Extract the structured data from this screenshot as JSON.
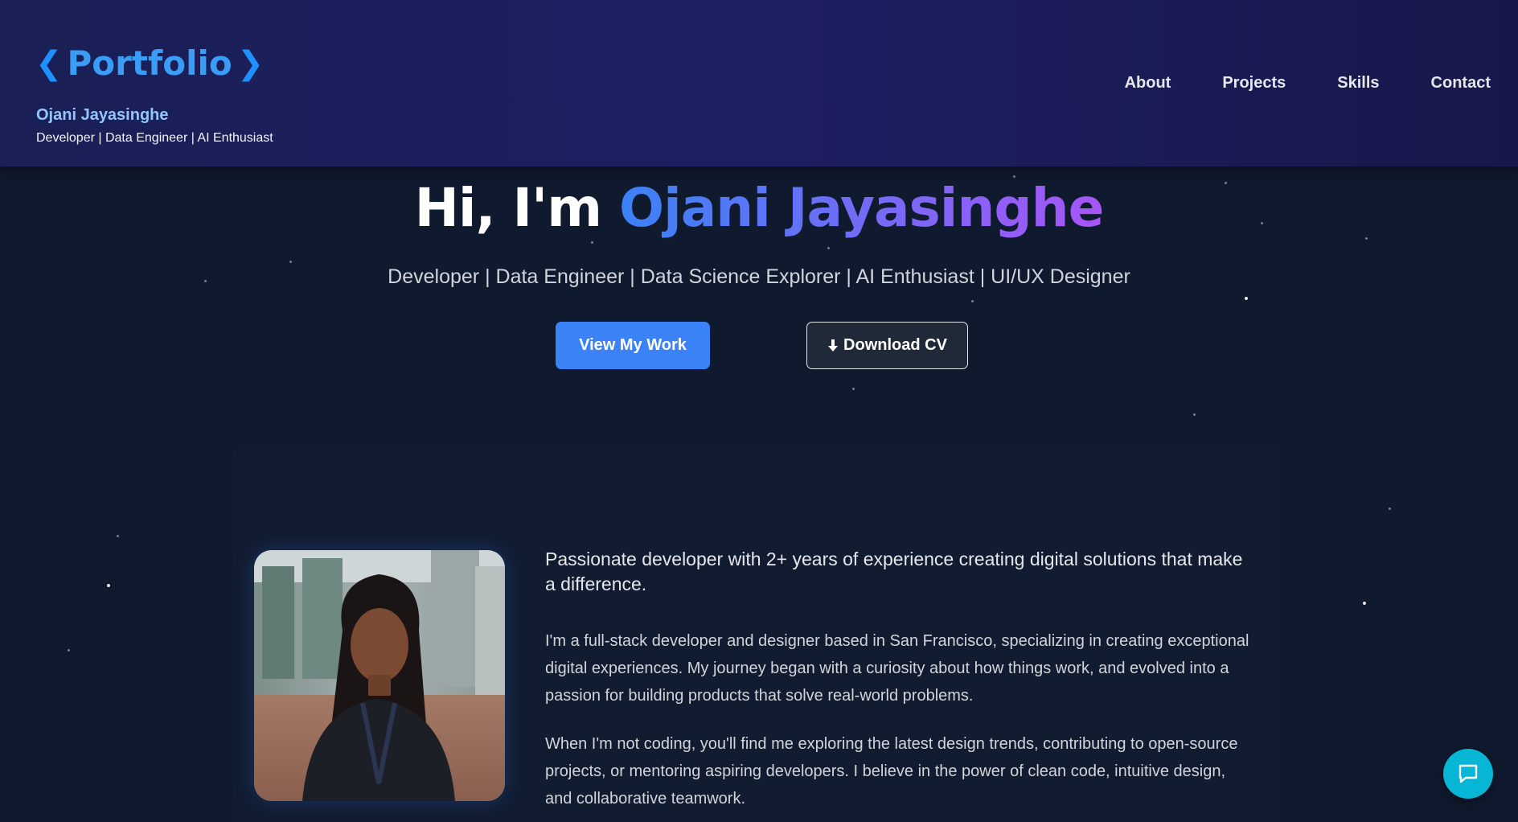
{
  "header": {
    "logo_text": "Portfolio",
    "owner_name": "Ojani Jayasinghe",
    "owner_tagline": "Developer | Data Engineer | AI Enthusiast",
    "nav": [
      {
        "label": "About"
      },
      {
        "label": "Projects"
      },
      {
        "label": "Skills"
      },
      {
        "label": "Contact"
      }
    ]
  },
  "hero": {
    "greeting": "Hi, I'm",
    "name": "Ojani Jayasinghe",
    "subtitle": "Developer | Data Engineer | Data Science Explorer | AI Enthusiast | UI/UX Designer",
    "primary_button": "View My Work",
    "secondary_button": "Download CV"
  },
  "about": {
    "lead": "Passionate developer with 2+ years of experience creating digital solutions that make a difference.",
    "paragraph1": "I'm a full-stack developer and designer based in San Francisco, specializing in creating exceptional digital experiences. My journey began with a curiosity about how things work, and evolved into a passion for building products that solve real-world problems.",
    "paragraph2": "When I'm not coding, you'll find me exploring the latest design trends, contributing to open-source projects, or mentoring aspiring developers. I believe in the power of clean code, intuitive design, and collaborative teamwork."
  },
  "icons": {
    "logo_left": "chevron-left-icon",
    "logo_right": "chevron-right-icon",
    "download": "download-icon",
    "chat": "chat-icon"
  },
  "colors": {
    "accent": "#3b82f6",
    "gradient_end": "#a855f7",
    "chat": "#06b6d4",
    "header_bg": "#1e1f63",
    "page_bg": "#0f1a2e"
  }
}
